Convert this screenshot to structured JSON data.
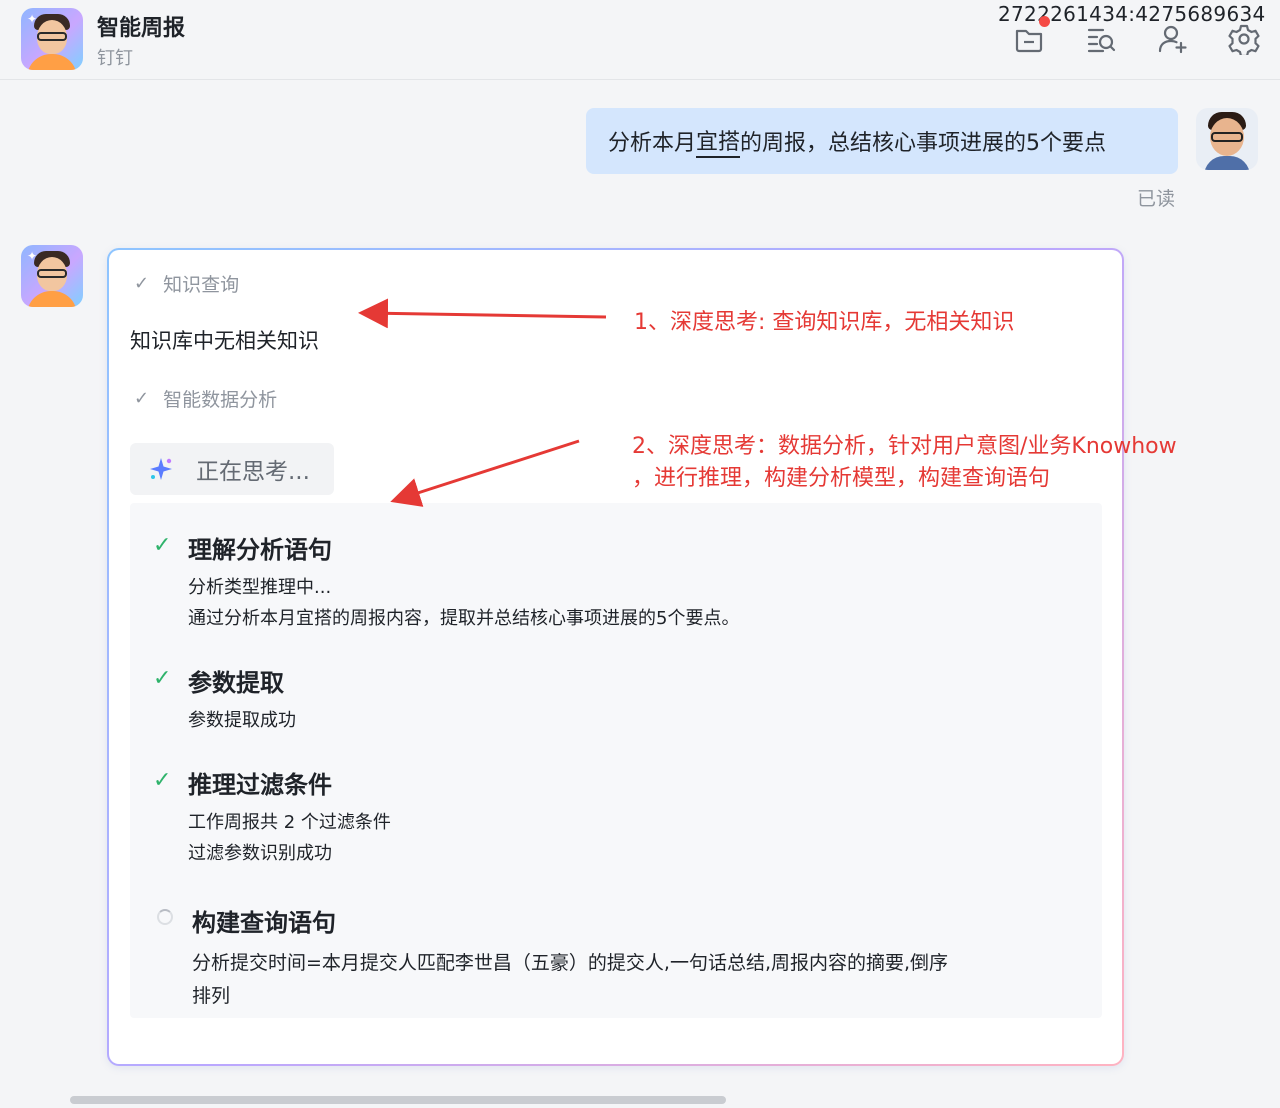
{
  "header": {
    "title": "智能周报",
    "subtitle": "钉钉",
    "watermark": "2722261434:4275689634",
    "icons": [
      "folder-icon",
      "search-list-icon",
      "add-member-icon",
      "settings-icon"
    ]
  },
  "user_message": {
    "text_before": "分析本月",
    "text_underlined": "宜搭",
    "text_after": "的周报，总结核心事项进展的5个要点",
    "read_status": "已读"
  },
  "bot_card": {
    "step1": {
      "label": "知识查询",
      "result": "知识库中无相关知识"
    },
    "step2": {
      "label": "智能数据分析"
    },
    "thinking_label": "正在思考...",
    "substeps": [
      {
        "title": "理解分析语句",
        "status": "done",
        "lines": [
          "分析类型推理中...",
          "通过分析本月宜搭的周报内容，提取并总结核心事项进展的5个要点。"
        ]
      },
      {
        "title": "参数提取",
        "status": "done",
        "lines": [
          "参数提取成功"
        ]
      },
      {
        "title": "推理过滤条件",
        "status": "done",
        "lines": [
          "工作周报共 2 个过滤条件",
          "过滤参数识别成功"
        ]
      },
      {
        "title": "构建查询语句",
        "status": "loading",
        "lines": [
          "分析提交时间=本月提交人匹配李世昌（五豪）的提交人,一句话总结,周报内容的摘要,倒序",
          "排列"
        ]
      }
    ]
  },
  "annotations": {
    "a1": "1、深度思考: 查询知识库，无相关知识",
    "a2_line1": "2、深度思考：数据分析，针对用户意图/业务Knowhow",
    "a2_line2": "，进行推理，构建分析模型，构建查询语句"
  },
  "colors": {
    "accent_green": "#2fb36b",
    "annotation_red": "#e53935",
    "user_bubble": "#d4e6fd"
  }
}
